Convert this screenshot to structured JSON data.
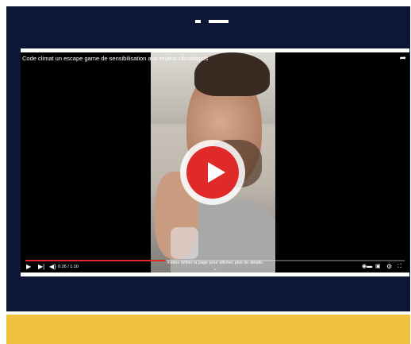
{
  "video": {
    "title": "Code climat un escape game de sensibilisation aux enjeux climatiques",
    "time": "0:26 / 1:10",
    "progress_fraction": 0.371,
    "scroll_hint": "Faites défiler la page pour afficher plus de détails"
  },
  "icons": {
    "share": "share-icon",
    "play_big": "play-icon",
    "play": "play-icon",
    "next": "next-icon",
    "volume": "volume-icon",
    "autoplay": "autoplay-toggle-icon",
    "subtitles": "subtitles-icon",
    "settings": "gear-icon",
    "fullscreen": "fullscreen-icon",
    "chevron": "chevron-down-icon"
  },
  "colors": {
    "navy": "#0c1637",
    "yellow": "#f0c23f",
    "accent": "#e02a2a"
  }
}
